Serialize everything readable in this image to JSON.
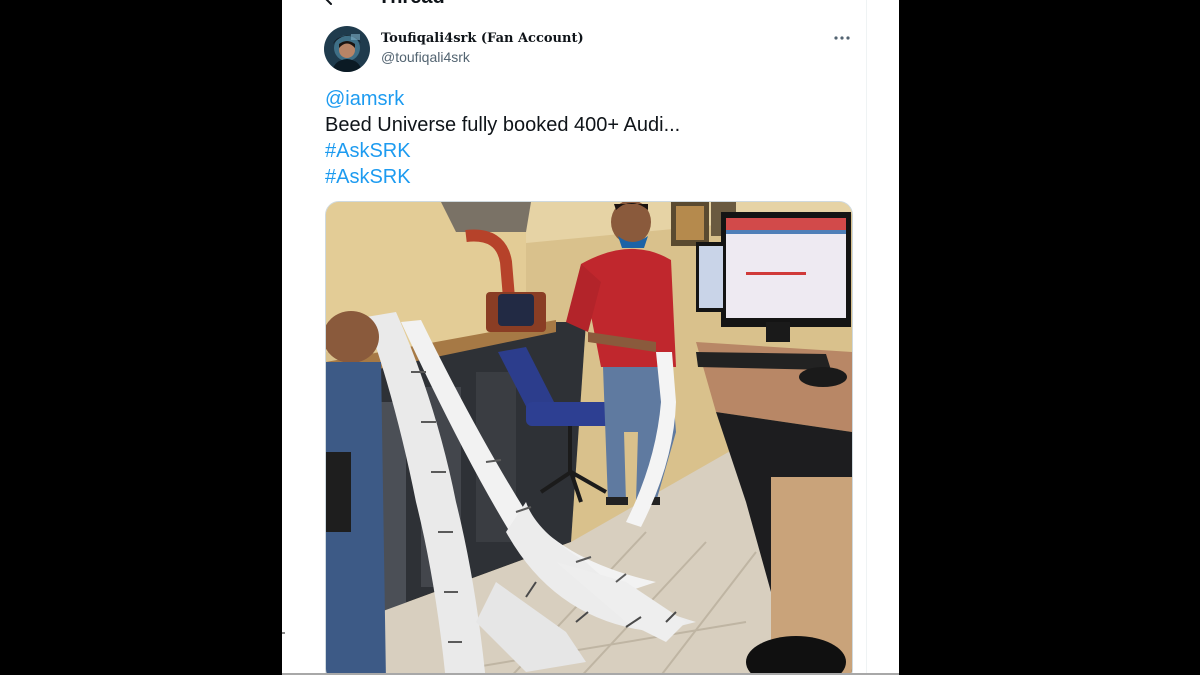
{
  "header": {
    "title": "Thread"
  },
  "tweet": {
    "display_name": "Toufiqali4srk (Fan Account)",
    "handle": "@toufiqali4srk",
    "mention": "@iamsrk",
    "text": "Beed Universe fully booked 400+ Audi...",
    "hashtags": [
      "#AskSRK",
      "#AskSRK"
    ],
    "more_icon": "more-horizontal-icon",
    "media": "photo-ticket-counter-with-printed-ticket-rolls"
  },
  "colors": {
    "link": "#1d9bf0",
    "text": "#0f1419",
    "secondary": "#536471",
    "background": "#ffffff",
    "letterbox": "#000000"
  }
}
